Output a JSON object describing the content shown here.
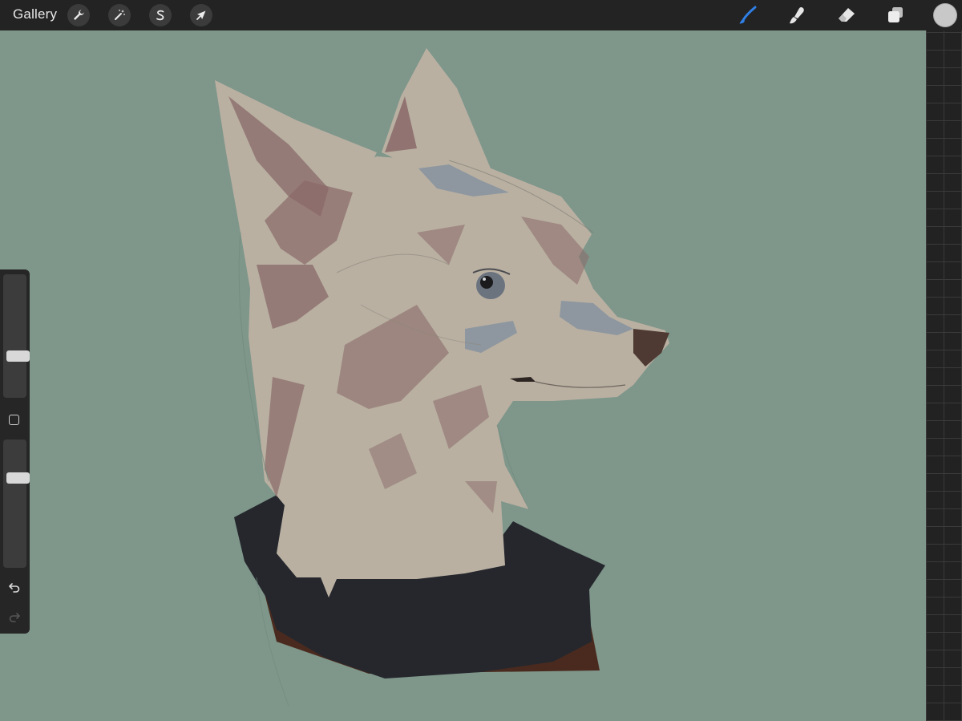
{
  "toolbar": {
    "gallery_label": "Gallery",
    "left_tools": [
      {
        "name": "actions",
        "icon": "wrench-icon"
      },
      {
        "name": "adjustments",
        "icon": "magic-wand-icon"
      },
      {
        "name": "selection",
        "icon": "selection-s-icon"
      },
      {
        "name": "transform",
        "icon": "arrow-cursor-icon"
      }
    ],
    "right_tools": [
      {
        "name": "brush",
        "icon": "brush-icon",
        "active": true
      },
      {
        "name": "smudge",
        "icon": "smudge-finger-icon",
        "active": false
      },
      {
        "name": "eraser",
        "icon": "eraser-icon",
        "active": false
      },
      {
        "name": "layers",
        "icon": "layers-icon",
        "active": false
      }
    ],
    "current_color": "#c8c8c8",
    "active_tool_color": "#2f7fe6"
  },
  "sidebar": {
    "brush_size_level": 0.32,
    "brush_opacity_level": 0.72,
    "buttons": [
      {
        "name": "modify",
        "icon": "square-modifier-icon"
      },
      {
        "name": "undo",
        "icon": "undo-icon"
      },
      {
        "name": "redo",
        "icon": "redo-icon",
        "enabled": false
      }
    ]
  },
  "canvas": {
    "background_color": "#7f968a",
    "artwork": "fox-portrait-illustration",
    "palette": {
      "fur": "#b9b0a2",
      "fur_shadow": "#8a6a68",
      "markings": "#8e979f",
      "jacket": "#25272d",
      "jacket_lining": "#4a2a1e",
      "nose": "#4e3a32",
      "eye": "#6b737f"
    }
  }
}
